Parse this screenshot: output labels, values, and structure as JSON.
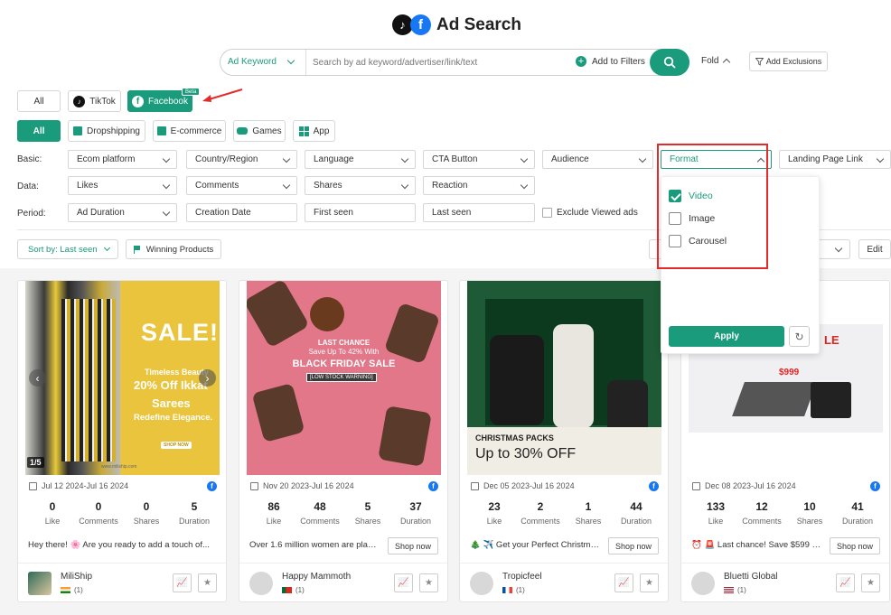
{
  "header": {
    "title": "Ad Search"
  },
  "search": {
    "type_label": "Ad Keyword",
    "placeholder": "Search by ad keyword/advertiser/link/text",
    "add_filters": "Add to Filters",
    "fold": "Fold",
    "add_exclusions": "Add Exclusions"
  },
  "platforms": {
    "all": "All",
    "tiktok": "TikTok",
    "facebook": "Facebook",
    "beta": "Beta"
  },
  "categories": {
    "all": "All",
    "dropshipping": "Dropshipping",
    "ecommerce": "E-commerce",
    "games": "Games",
    "app": "App"
  },
  "filters": {
    "basic_label": "Basic:",
    "data_label": "Data:",
    "period_label": "Period:",
    "ecom_platform": "Ecom platform",
    "country_region": "Country/Region",
    "language": "Language",
    "cta_button": "CTA Button",
    "audience": "Audience",
    "format": "Format",
    "landing_page_link": "Landing Page Link",
    "likes": "Likes",
    "comments": "Comments",
    "shares": "Shares",
    "reaction": "Reaction",
    "ad_duration": "Ad Duration",
    "creation_date": "Creation Date",
    "first_seen": "First seen",
    "last_seen": "Last seen",
    "exclude_viewed": "Exclude Viewed ads"
  },
  "toolbar": {
    "sort": "Sort by: Last seen",
    "winning_products": "Winning Products",
    "edit": "Edit"
  },
  "format_dropdown": {
    "options": [
      {
        "label": "Video",
        "checked": true
      },
      {
        "label": "Image",
        "checked": false
      },
      {
        "label": "Carousel",
        "checked": false
      }
    ],
    "apply": "Apply"
  },
  "cards": [
    {
      "date": "Jul 12 2024-Jul 16 2024",
      "likes": "0",
      "comments": "0",
      "shares": "0",
      "duration": "5",
      "desc": "Hey there! 🌸 Are you ready to add a touch of...",
      "advertiser": "MiliShip",
      "count": "(1)",
      "page": "1/5",
      "thumb": {
        "sale": "SALE!",
        "line1": "Timeless Beauty",
        "line2": "20% Off Ikkat",
        "line3": "Sarees",
        "line4": "Redefine Elegance.",
        "shop": "SHOP NOW",
        "url": "www.miliship.com"
      }
    },
    {
      "date": "Nov 20 2023-Jul 16 2024",
      "likes": "86",
      "comments": "48",
      "shares": "5",
      "duration": "37",
      "desc": "Over 1.6 million women are placi...",
      "advertiser": "Happy Mammoth",
      "count": "(1)",
      "thumb": {
        "line1": "LAST CHANCE",
        "line2": "Save Up To 42% With",
        "line3": "BLACK FRIDAY SALE",
        "line4": "[LOW STOCK WARNING]"
      }
    },
    {
      "date": "Dec 05 2023-Jul 16 2024",
      "likes": "23",
      "comments": "2",
      "shares": "1",
      "duration": "44",
      "desc": "🎄 ✈️ Get your Perfect Christmas...",
      "advertiser": "Tropicfeel",
      "count": "(1)",
      "thumb": {
        "line1": "CHRISTMAS PACKS",
        "line2": "Up to 30% OFF"
      }
    },
    {
      "date": "Dec 08 2023-Jul 16 2024",
      "likes": "133",
      "comments": "12",
      "shares": "10",
      "duration": "41",
      "desc": "⏰ 🚨 Last chance! Save $599 on...",
      "advertiser": "Bluetti Global",
      "count": "(1)",
      "thumb": {
        "price": "$999",
        "frag": "LE"
      }
    }
  ],
  "stat_labels": {
    "likes": "Like",
    "comments": "Comments",
    "shares": "Shares",
    "duration": "Duration"
  },
  "shop_now": "Shop now",
  "colors": {
    "accent": "#1a9b7b",
    "highlight": "#e52a2a",
    "facebook": "#1877f2"
  }
}
